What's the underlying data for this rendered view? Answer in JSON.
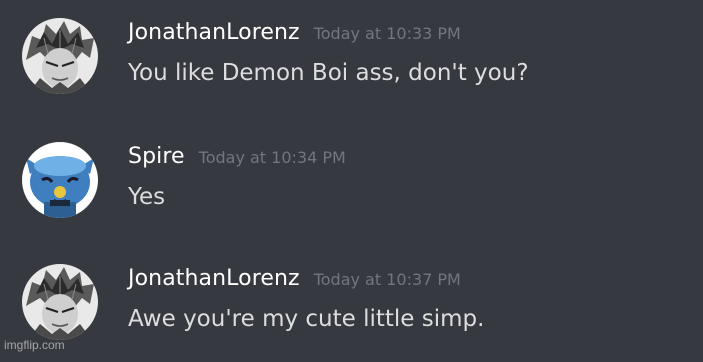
{
  "messages": [
    {
      "username": "JonathanLorenz",
      "timestamp": "Today at 10:33 PM",
      "content": "You like Demon Boi ass, don't you?",
      "avatar": "grayscale-anime-avatar"
    },
    {
      "username": "Spire",
      "timestamp": "Today at 10:34 PM",
      "content": "Yes",
      "avatar": "blue-creature-avatar"
    },
    {
      "username": "JonathanLorenz",
      "timestamp": "Today at 10:37 PM",
      "content": "Awe you're my cute little simp.",
      "avatar": "grayscale-anime-avatar"
    }
  ],
  "watermark": "imgflip.com",
  "colors": {
    "background": "#36393f",
    "username": "#ffffff",
    "timestamp": "#72767d",
    "message_text": "#dcddde"
  }
}
